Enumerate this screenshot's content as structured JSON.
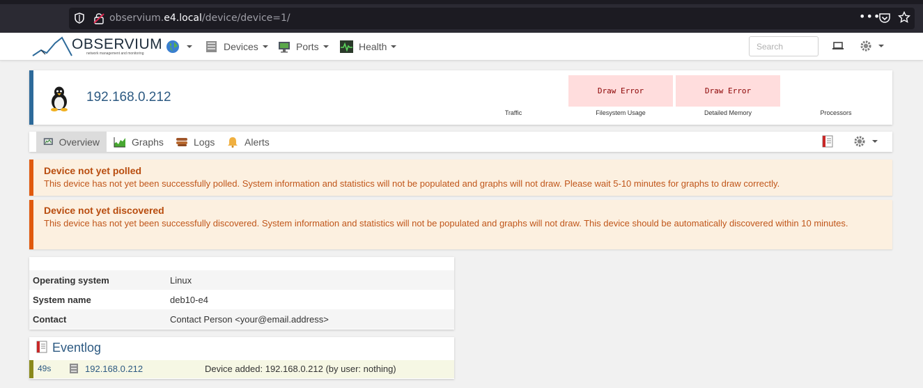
{
  "browser": {
    "url_prefix": "observium.",
    "url_host": "e4.local",
    "url_path": "/device/device=1/"
  },
  "navbar": {
    "logo_title": "OBSERVIUM",
    "logo_subtitle": "network management and monitoring",
    "items": [
      {
        "label": "Devices",
        "icon": "server-icon"
      },
      {
        "label": "Ports",
        "icon": "monitor-icon"
      },
      {
        "label": "Health",
        "icon": "heartbeat-icon"
      }
    ],
    "search_placeholder": "Search"
  },
  "device": {
    "hostname": "192.168.0.212",
    "os_icon": "tux-icon",
    "graphs": [
      {
        "label": "Traffic",
        "error": ""
      },
      {
        "label": "Filesystem Usage",
        "error": "Draw Error"
      },
      {
        "label": "Detailed Memory",
        "error": "Draw Error"
      },
      {
        "label": "Processors",
        "error": ""
      }
    ]
  },
  "tabs": [
    {
      "label": "Overview",
      "active": true
    },
    {
      "label": "Graphs",
      "active": false
    },
    {
      "label": "Logs",
      "active": false
    },
    {
      "label": "Alerts",
      "active": false
    }
  ],
  "alerts": [
    {
      "title": "Device not yet polled",
      "text": "This device has not yet been successfully polled. System information and statistics will not be populated and graphs will not draw. Please wait 5-10 minutes for graphs to draw correctly."
    },
    {
      "title": "Device not yet discovered",
      "text": "This device has not yet been successfully discovered. System information and statistics will not be populated and graphs will not draw. This device should be automatically discovered within 10 minutes."
    }
  ],
  "info": [
    {
      "key": "Operating system",
      "value": "Linux"
    },
    {
      "key": "System name",
      "value": "deb10-e4"
    },
    {
      "key": "Contact",
      "value": "Contact Person <your@email.address>"
    }
  ],
  "eventlog": {
    "title": "Eventlog",
    "entries": [
      {
        "time": "49s",
        "host": "192.168.0.212",
        "message": "Device added: 192.168.0.212 (by user: nothing)"
      }
    ]
  },
  "colors": {
    "accent_blue": "#2d6a9a",
    "alert_orange": "#e05a0e",
    "draw_error_bg": "#ffdddd"
  }
}
